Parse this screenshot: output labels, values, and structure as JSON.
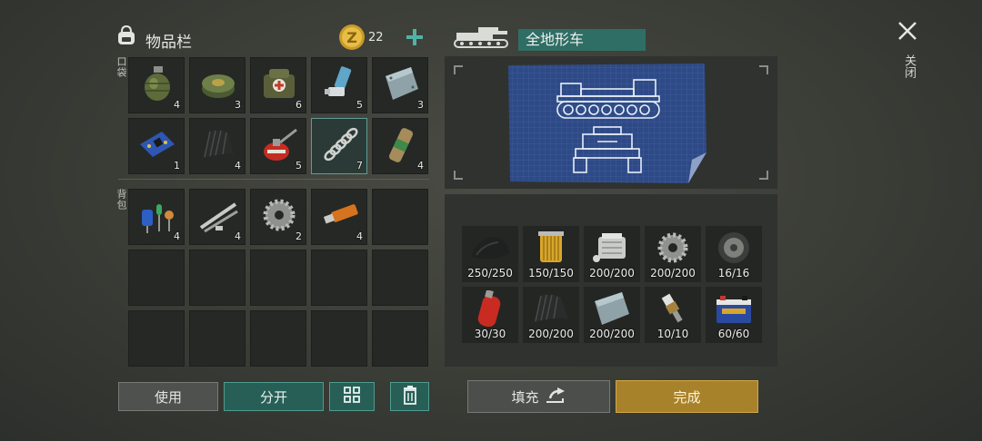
{
  "inventory": {
    "title": "物品栏",
    "coins": "22",
    "pocket_label": "口袋",
    "backpack_label": "背包",
    "pocket": [
      {
        "icon": "grenade-icon",
        "count": "4"
      },
      {
        "icon": "landmine-icon",
        "count": "3"
      },
      {
        "icon": "medkit-bag-icon",
        "count": "6"
      },
      {
        "icon": "inhaler-icon",
        "count": "5"
      },
      {
        "icon": "metal-plate-icon",
        "count": "3"
      },
      {
        "icon": "circuit-board-icon",
        "count": "1"
      },
      {
        "icon": "rubber-sheet-icon",
        "count": "4"
      },
      {
        "icon": "oil-can-icon",
        "count": "5"
      },
      {
        "icon": "spring-icon",
        "count": "7"
      },
      {
        "icon": "flare-canister-icon",
        "count": "4"
      }
    ],
    "backpack": [
      {
        "icon": "electronic-components-icon",
        "count": "4"
      },
      {
        "icon": "metal-rods-icon",
        "count": "4"
      },
      {
        "icon": "gear-icon",
        "count": "2"
      },
      {
        "icon": "usb-drive-icon",
        "count": "4"
      }
    ],
    "buttons": {
      "use": "使用",
      "split": "分开"
    }
  },
  "craft": {
    "vehicle_name": "全地形车",
    "close_label": "关闭",
    "resources": [
      {
        "icon": "rubber-sheet-icon",
        "amount": "250/250"
      },
      {
        "icon": "oil-filter-icon",
        "amount": "150/150"
      },
      {
        "icon": "engine-block-icon",
        "amount": "200/200"
      },
      {
        "icon": "gear-icon",
        "amount": "200/200"
      },
      {
        "icon": "wheel-icon",
        "amount": "16/16"
      },
      {
        "icon": "gas-cylinder-icon",
        "amount": "30/30"
      },
      {
        "icon": "rubber-sheet-icon",
        "amount": "200/200"
      },
      {
        "icon": "metal-plate-icon",
        "amount": "200/200"
      },
      {
        "icon": "spark-plug-icon",
        "amount": "10/10"
      },
      {
        "icon": "car-battery-icon",
        "amount": "60/60"
      }
    ],
    "buttons": {
      "fill": "填充",
      "done": "完成"
    }
  }
}
